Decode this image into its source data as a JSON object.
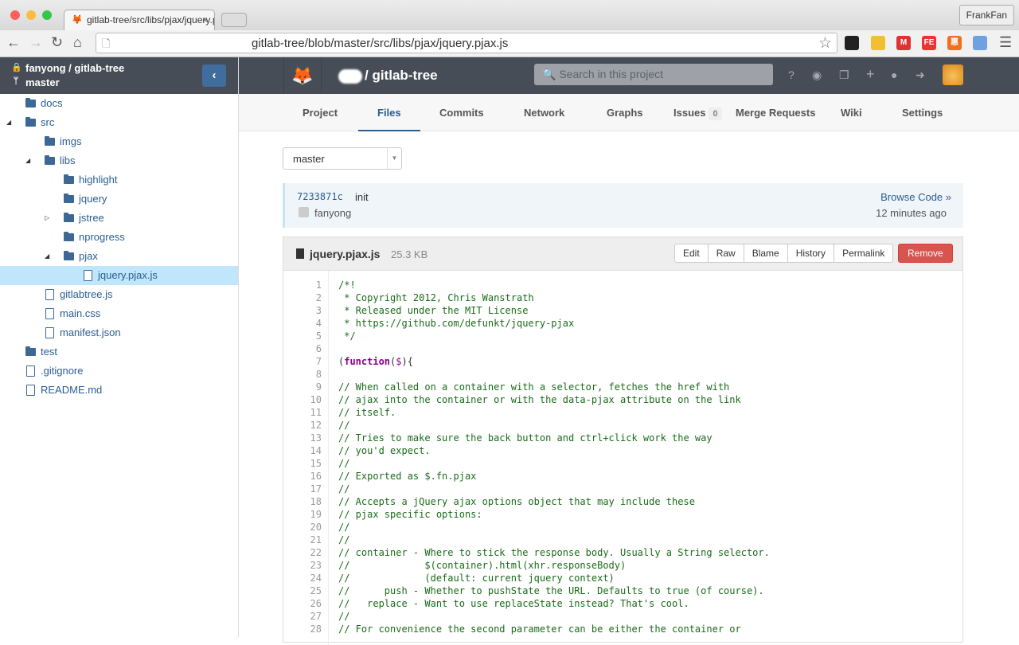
{
  "browser": {
    "tab_title": "gitlab-tree/src/libs/pjax/jquery.pjax.js",
    "url": "gitlab-tree/blob/master/src/libs/pjax/jquery.pjax.js",
    "profile": "FrankFan"
  },
  "sidebar": {
    "owner": "fanyong",
    "repo": "gitlab-tree",
    "branch": "master",
    "tree": [
      {
        "label": "docs",
        "type": "folder",
        "depth": 0,
        "state": "none"
      },
      {
        "label": "src",
        "type": "folder",
        "depth": 0,
        "state": "open"
      },
      {
        "label": "imgs",
        "type": "folder",
        "depth": 1,
        "state": "none"
      },
      {
        "label": "libs",
        "type": "folder",
        "depth": 1,
        "state": "open"
      },
      {
        "label": "highlight",
        "type": "folder",
        "depth": 2,
        "state": "none"
      },
      {
        "label": "jquery",
        "type": "folder",
        "depth": 2,
        "state": "none"
      },
      {
        "label": "jstree",
        "type": "folder",
        "depth": 2,
        "state": "closed"
      },
      {
        "label": "nprogress",
        "type": "folder",
        "depth": 2,
        "state": "none"
      },
      {
        "label": "pjax",
        "type": "folder",
        "depth": 2,
        "state": "open"
      },
      {
        "label": "jquery.pjax.js",
        "type": "file",
        "depth": 3,
        "state": "none",
        "selected": true
      },
      {
        "label": "gitlabtree.js",
        "type": "file",
        "depth": 1,
        "state": "none"
      },
      {
        "label": "main.css",
        "type": "file",
        "depth": 1,
        "state": "none"
      },
      {
        "label": "manifest.json",
        "type": "file",
        "depth": 1,
        "state": "none"
      },
      {
        "label": "test",
        "type": "folder",
        "depth": 0,
        "state": "none"
      },
      {
        "label": ".gitignore",
        "type": "file",
        "depth": 0,
        "state": "none"
      },
      {
        "label": "README.md",
        "type": "file",
        "depth": 0,
        "state": "none"
      }
    ]
  },
  "header": {
    "project": "/ gitlab-tree",
    "search_placeholder": "Search in this project"
  },
  "nav": [
    {
      "label": "Project"
    },
    {
      "label": "Files",
      "active": true
    },
    {
      "label": "Commits"
    },
    {
      "label": "Network"
    },
    {
      "label": "Graphs"
    },
    {
      "label": "Issues",
      "badge": "0"
    },
    {
      "label": "Merge Requests"
    },
    {
      "label": "Wiki"
    },
    {
      "label": "Settings"
    }
  ],
  "branch_select": "master",
  "commit": {
    "sha": "7233871c",
    "message": "init",
    "author": "fanyong",
    "browse": "Browse Code »",
    "time": "12 minutes ago"
  },
  "file": {
    "name": "jquery.pjax.js",
    "size": "25.3 KB",
    "buttons": [
      "Edit",
      "Raw",
      "Blame",
      "History",
      "Permalink"
    ],
    "remove": "Remove"
  },
  "code": [
    "/*!",
    " * Copyright 2012, Chris Wanstrath",
    " * Released under the MIT License",
    " * https://github.com/defunkt/jquery-pjax",
    " */",
    "",
    "(function($){",
    "",
    "// When called on a container with a selector, fetches the href with",
    "// ajax into the container or with the data-pjax attribute on the link",
    "// itself.",
    "//",
    "// Tries to make sure the back button and ctrl+click work the way",
    "// you'd expect.",
    "//",
    "// Exported as $.fn.pjax",
    "//",
    "// Accepts a jQuery ajax options object that may include these",
    "// pjax specific options:",
    "//",
    "//",
    "// container - Where to stick the response body. Usually a String selector.",
    "//             $(container).html(xhr.responseBody)",
    "//             (default: current jquery context)",
    "//      push - Whether to pushState the URL. Defaults to true (of course).",
    "//   replace - Want to use replaceState instead? That's cool.",
    "//",
    "// For convenience the second parameter can be either the container or"
  ]
}
